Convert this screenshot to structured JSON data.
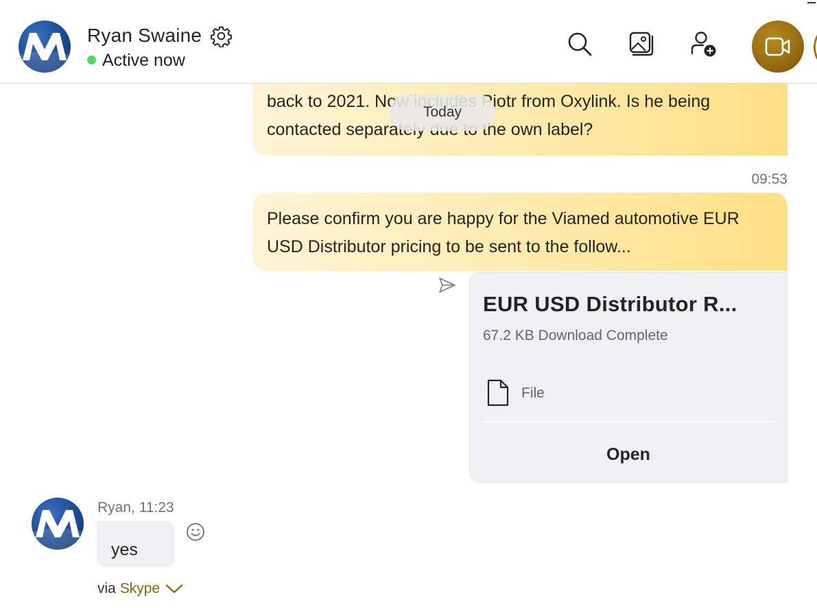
{
  "header": {
    "contact_name": "Ryan Swaine",
    "presence": "Active now",
    "presence_color": "#4cd964",
    "icons": [
      "gear-icon",
      "search-icon",
      "gallery-icon",
      "add-person-icon",
      "video-camera-icon"
    ]
  },
  "conversation": {
    "date_separator": "Today",
    "messages": [
      {
        "direction": "outgoing",
        "text": "back to 2021. Now includes Piotr from Oxylink. Is he being\ncontacted separately due to the own label?"
      },
      {
        "direction": "outgoing",
        "time": "09:53",
        "text": "Please confirm you are happy for the Viamed automotive EUR\nUSD Distributor pricing to be sent to the follow..."
      }
    ],
    "file": {
      "title": "EUR USD Distributor R...",
      "meta": "67.2 KB Download Complete",
      "type_label": "File",
      "open_label": "Open"
    },
    "incoming": {
      "meta": "Ryan, 11:23",
      "text": "yes",
      "via_prefix": "via",
      "via_link": "Skype"
    }
  },
  "colors": {
    "accent": "#8f6410",
    "bubble_out_start": "#fff4d6",
    "bubble_out_end": "#ffdf86",
    "bubble_in": "#f0f0f2"
  }
}
